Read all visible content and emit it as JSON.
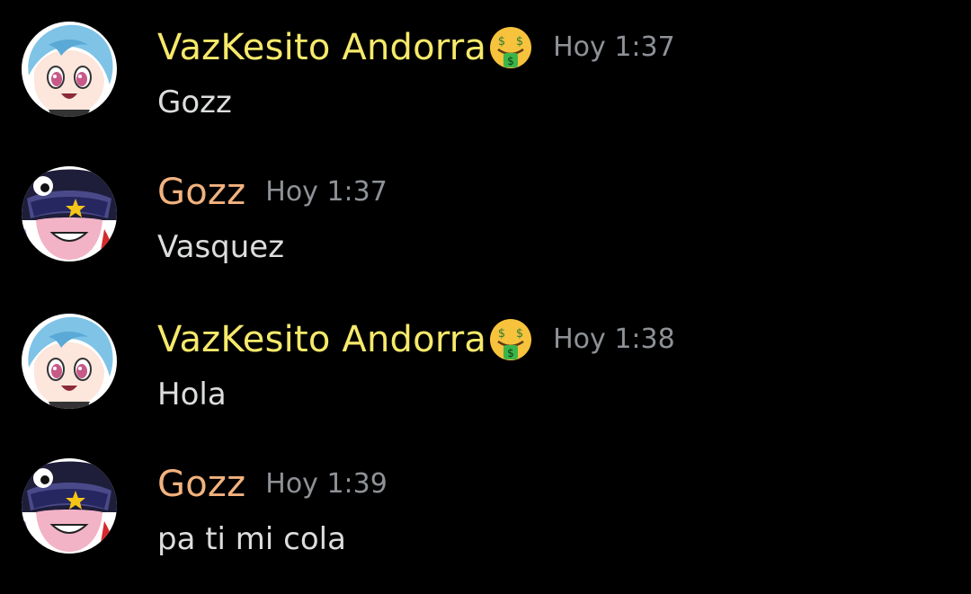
{
  "colors": {
    "background": "#000000",
    "vaz_name": "#f6e96b",
    "gozz_name": "#f2b27e",
    "timestamp": "#8e9297",
    "message_text": "#dcddde"
  },
  "messages": [
    {
      "author": "VazKesito Andorra",
      "badge_icon": "money-mouth-face-icon",
      "time": "Hoy 1:37",
      "text": "Gozz"
    },
    {
      "author": "Gozz",
      "time": "Hoy 1:37",
      "text": "Vasquez"
    },
    {
      "author": "VazKesito Andorra",
      "badge_icon": "money-mouth-face-icon",
      "time": "Hoy 1:38",
      "text": "Hola"
    },
    {
      "author": "Gozz",
      "time": "Hoy 1:39",
      "text": "pa ti mi cola"
    }
  ]
}
